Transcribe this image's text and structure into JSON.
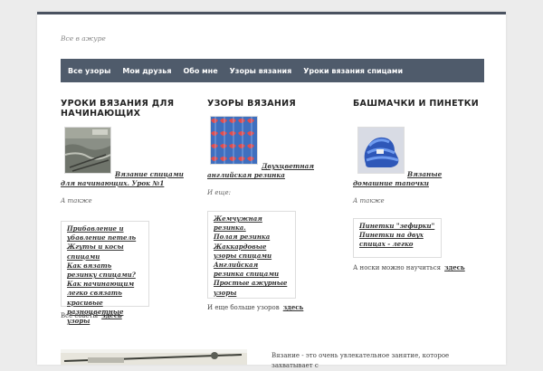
{
  "site": {
    "tagline": "Все в ажуре"
  },
  "nav": [
    "Все узоры",
    "Мои друзья",
    "Обо мне",
    "Узоры вязания",
    "Уроки вязания спицами"
  ],
  "columns": [
    {
      "title": "УРОКИ ВЯЗАНИЯ ДЛЯ НАЧИНАЮЩИХ",
      "caption": "Вязание спицами для начинающих. Урок №1",
      "note": "А также",
      "links": [
        "Прибавление и убавление петель",
        "Жгуты и косы спицами",
        "Как вязать резинку спицами?",
        "Как начинающим легко связать красивые разноцветные узоры"
      ],
      "more_text": "Все советы",
      "more_link": "здесь"
    },
    {
      "title": "УЗОРЫ ВЯЗАНИЯ",
      "caption": "Двухцветная английская резинка",
      "note": "И еще:",
      "links": [
        "Жемчужная резинка.",
        "Полая резинка",
        "Жаккардовые узоры спицами",
        "Английская резинка спицами",
        "Простые ажурные узоры"
      ],
      "more_text": "И еще больше узоров",
      "more_link": "здесь"
    },
    {
      "title": "БАШМАЧКИ И ПИНЕТКИ",
      "caption": "Вязаные домашние тапочки",
      "note": "А также",
      "links": [
        "Пинетки \"зефирки\"",
        "Пинетки на двух спицах - легко"
      ],
      "more_text": "А носки можно научиться",
      "more_link": "здесь"
    }
  ],
  "bottom": {
    "text": "Вязание - это очень увлекательное занятие, которое захватывает с"
  }
}
